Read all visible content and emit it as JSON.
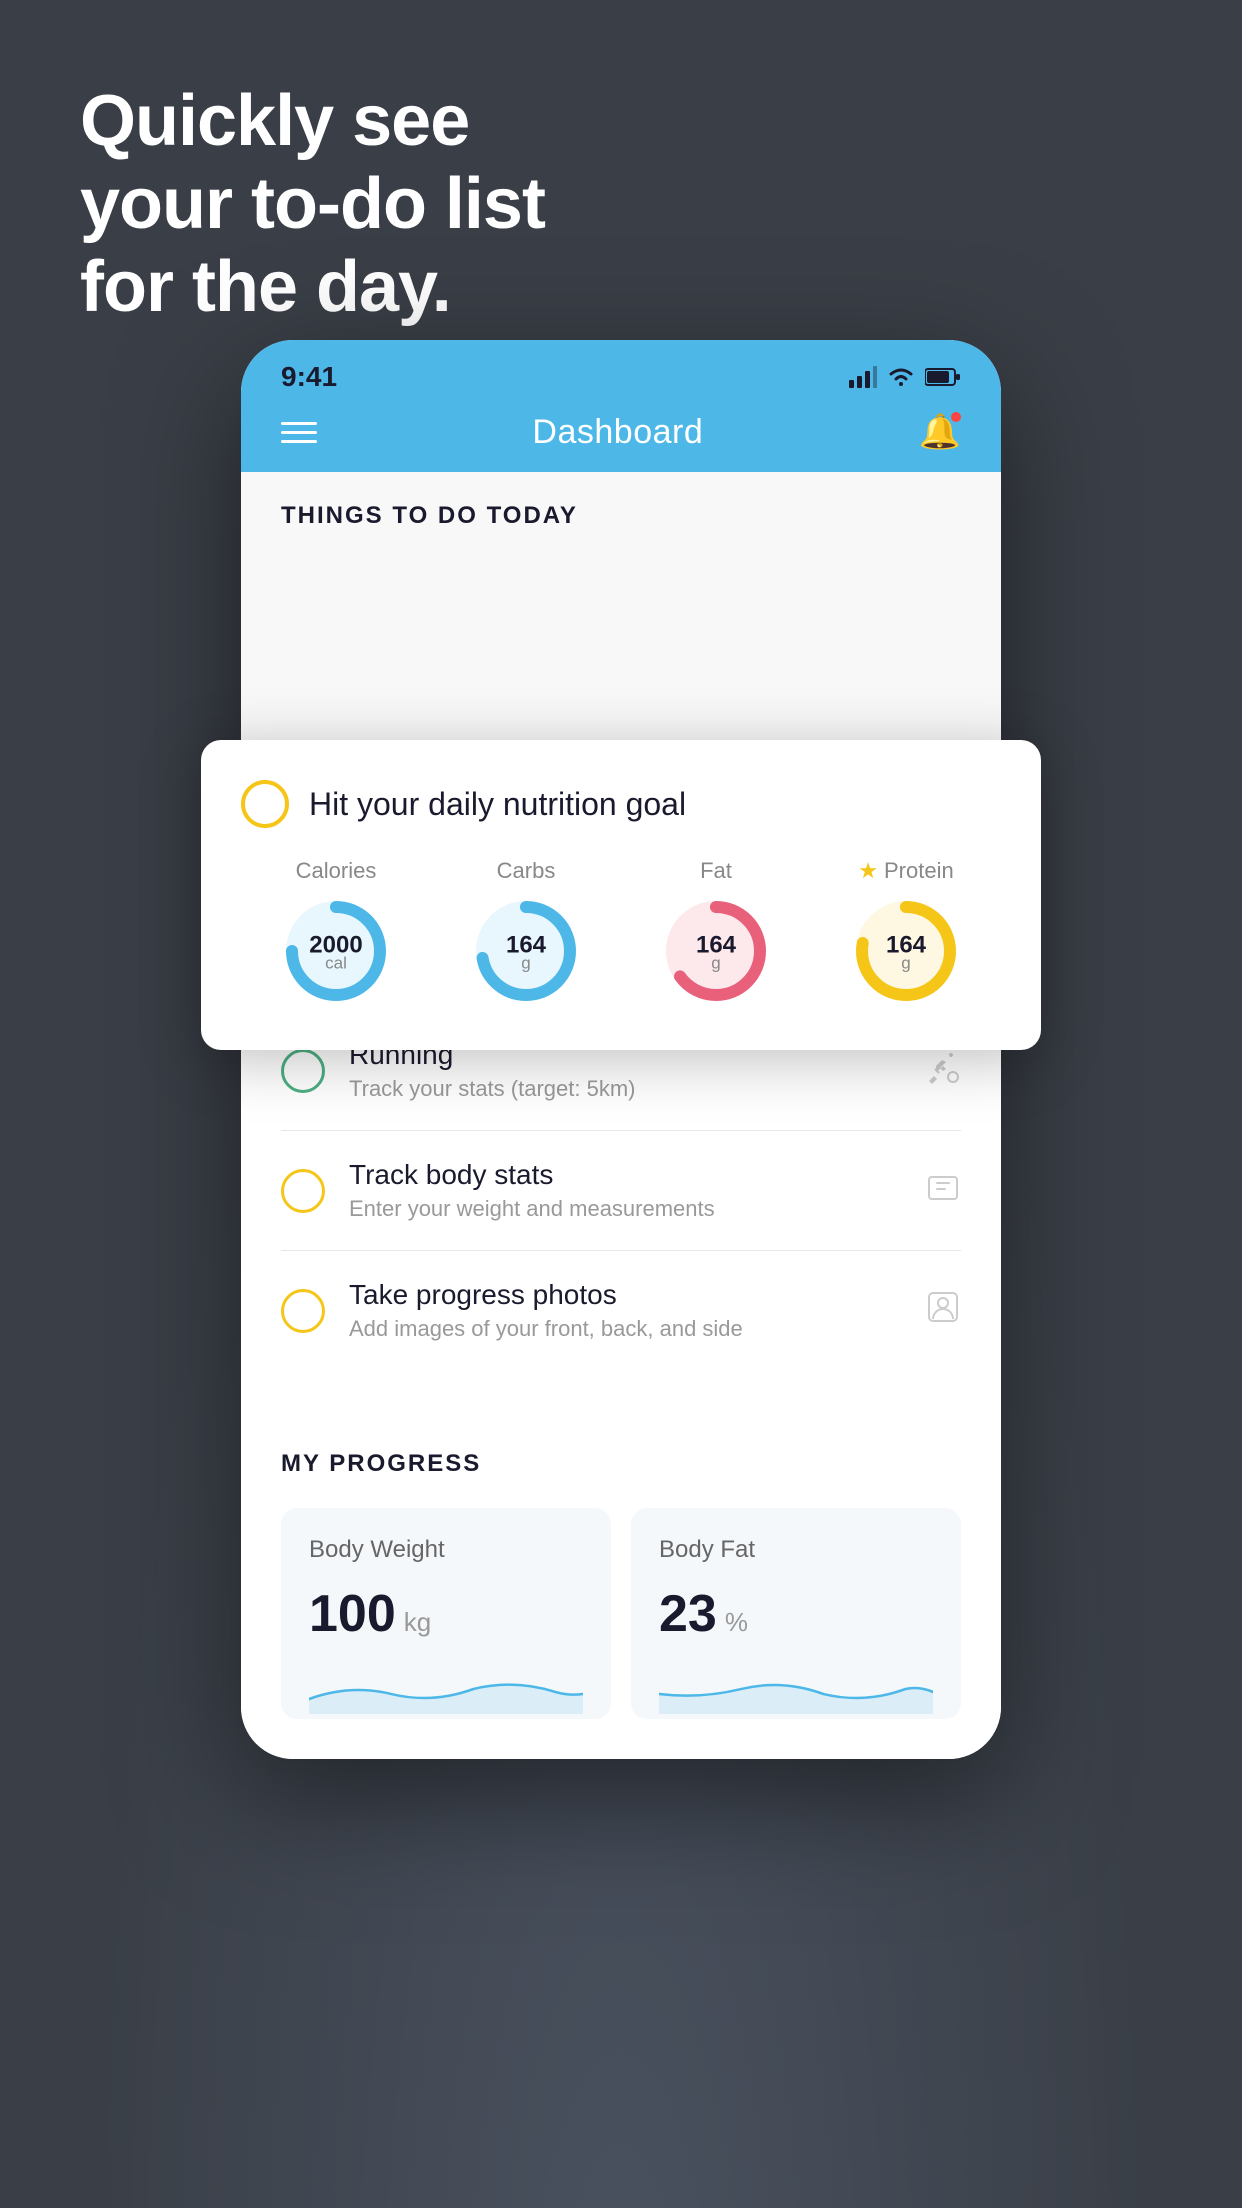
{
  "hero": {
    "line1": "Quickly see",
    "line2": "your to-do list",
    "line3": "for the day."
  },
  "statusBar": {
    "time": "9:41",
    "signal": "▌▌▌▌",
    "wifi": "wifi",
    "battery": "battery"
  },
  "navbar": {
    "title": "Dashboard"
  },
  "thingsSection": {
    "header": "THINGS TO DO TODAY"
  },
  "floatingCard": {
    "circleColor": "#f5c518",
    "title": "Hit your daily nutrition goal",
    "nutrition": [
      {
        "label": "Calories",
        "value": "2000",
        "unit": "cal",
        "color": "#4db8e8",
        "trackColor": "#e8f6fd",
        "star": false
      },
      {
        "label": "Carbs",
        "value": "164",
        "unit": "g",
        "color": "#4db8e8",
        "trackColor": "#e8f6fd",
        "star": false
      },
      {
        "label": "Fat",
        "value": "164",
        "unit": "g",
        "color": "#e8607a",
        "trackColor": "#fde8ec",
        "star": false
      },
      {
        "label": "Protein",
        "value": "164",
        "unit": "g",
        "color": "#f5c518",
        "trackColor": "#fef8e3",
        "star": true
      }
    ]
  },
  "todoItems": [
    {
      "checkType": "green",
      "title": "Running",
      "subtitle": "Track your stats (target: 5km)",
      "icon": "shoe"
    },
    {
      "checkType": "yellow",
      "title": "Track body stats",
      "subtitle": "Enter your weight and measurements",
      "icon": "scale"
    },
    {
      "checkType": "yellow",
      "title": "Take progress photos",
      "subtitle": "Add images of your front, back, and side",
      "icon": "person"
    }
  ],
  "progressSection": {
    "header": "MY PROGRESS",
    "cards": [
      {
        "title": "Body Weight",
        "value": "100",
        "unit": "kg"
      },
      {
        "title": "Body Fat",
        "value": "23",
        "unit": "%"
      }
    ]
  }
}
